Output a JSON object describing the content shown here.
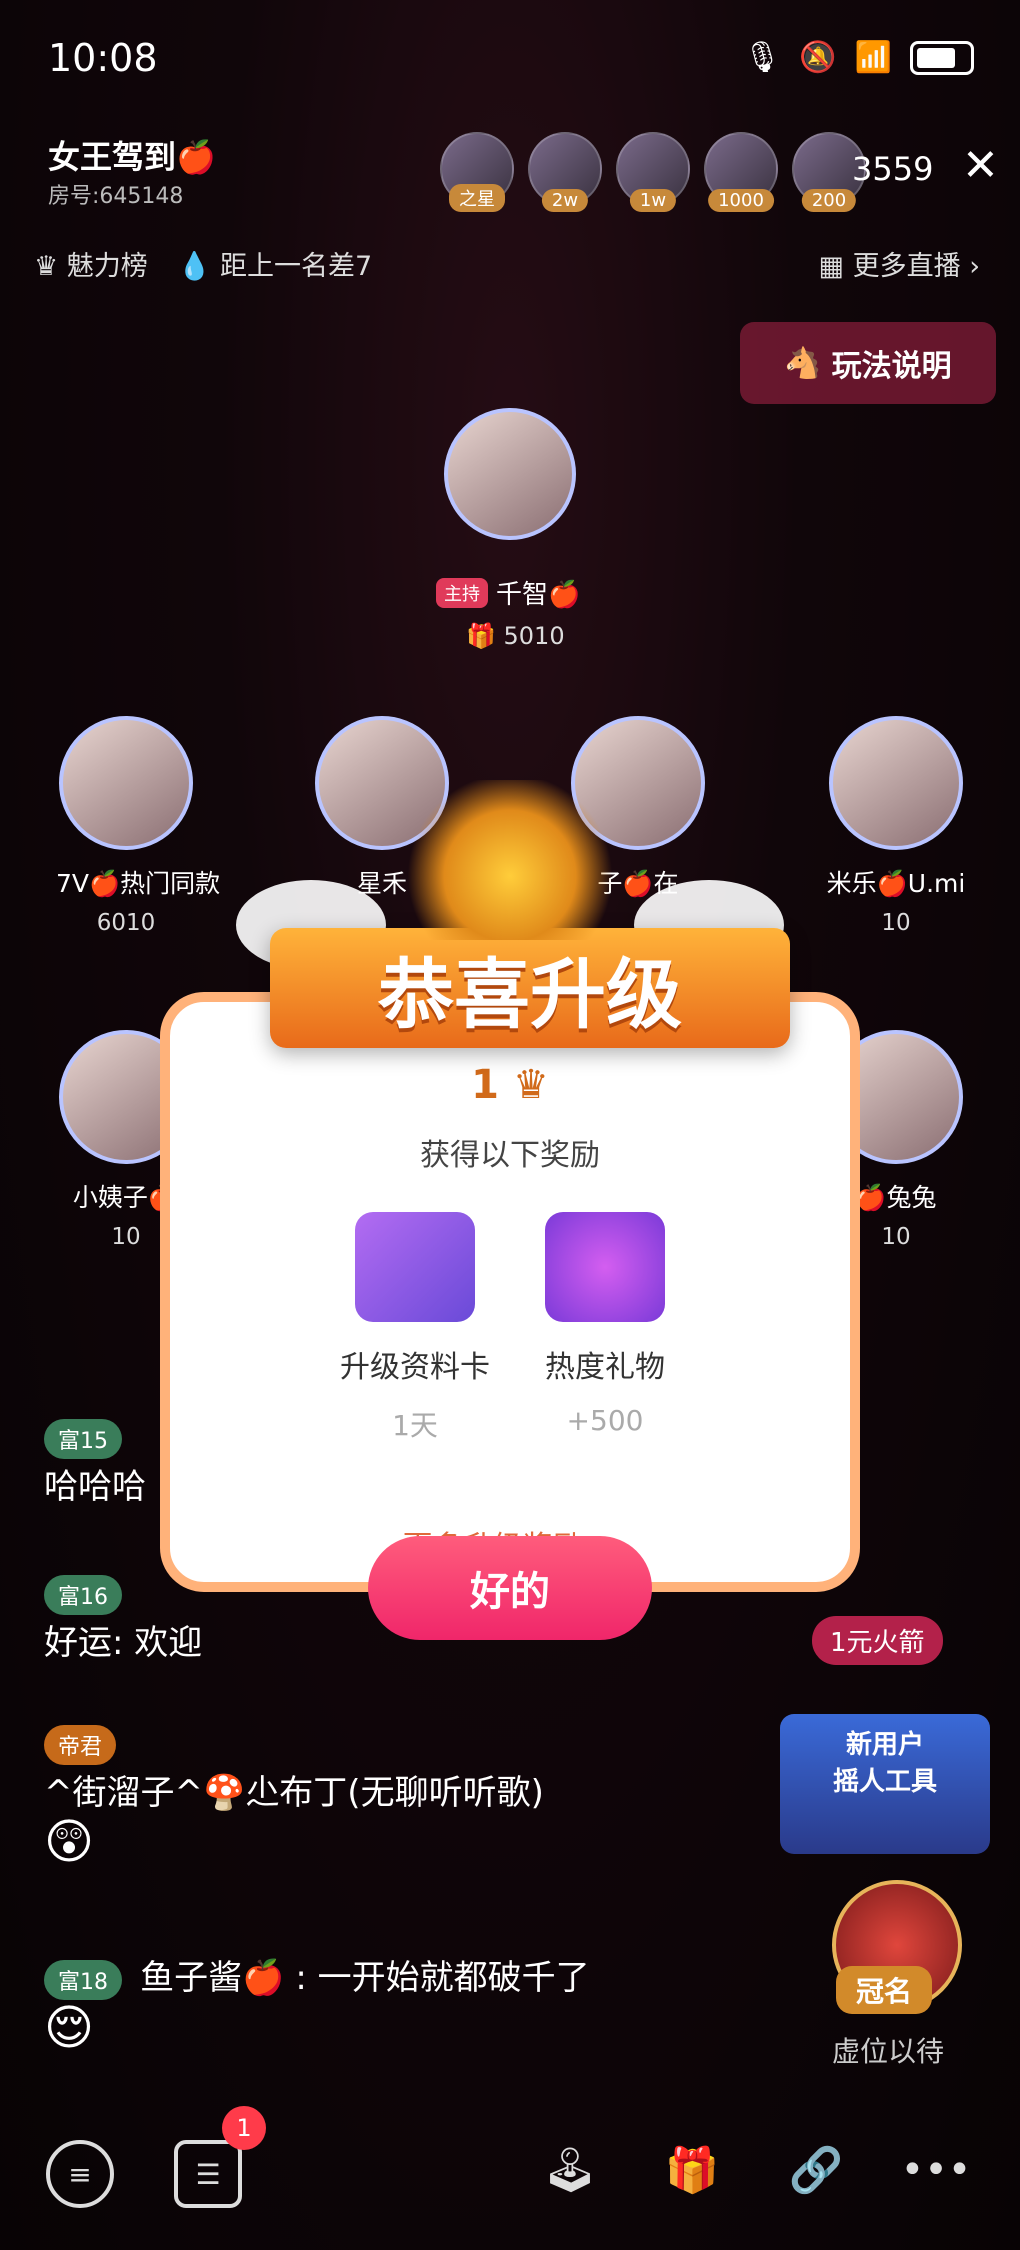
{
  "status": {
    "time": "10:08"
  },
  "header": {
    "room_title": "女王驾到🍎",
    "room_id": "房号:645148",
    "viewers": [
      {
        "tag": "之星"
      },
      {
        "tag": "2w"
      },
      {
        "tag": "1w"
      },
      {
        "tag": "1000"
      },
      {
        "tag": "200"
      }
    ],
    "viewer_count": "3559"
  },
  "subbar": {
    "charm_rank": "魅力榜",
    "rank_gap": "距上一名差7",
    "more_live": "更多直播",
    "rules": "玩法说明"
  },
  "host": {
    "tag": "主持",
    "name": "千智🍎",
    "score": "5010"
  },
  "seats": [
    {
      "name": "7V🍎热门同款",
      "score": "6010"
    },
    {
      "name": "星禾",
      "score": ""
    },
    {
      "name": "子🍎在",
      "score": ""
    },
    {
      "name": "米乐🍎U.mi",
      "score": "10"
    },
    {
      "name": "小姨子🍎",
      "score": "10"
    },
    {
      "name": "🍎兔兔",
      "score": "10"
    }
  ],
  "chat": [
    {
      "level": "富15",
      "text": "哈哈哈"
    },
    {
      "level": "富16",
      "text": "好运: 欢迎"
    },
    {
      "level": "帝君",
      "text": "^街溜子^🍄尐布丁(无聊听听歌)"
    },
    {
      "level": "富18",
      "text": "鱼子酱🍎 : 一开始就都破千了"
    }
  ],
  "right": {
    "rocket": "1元火箭",
    "new_user": "新用户\n摇人工具",
    "sponsor_label": "冠名",
    "sponsor_sub": "虚位以待"
  },
  "modal": {
    "title": "恭喜升级",
    "level": "1",
    "reward_title": "获得以下奖励",
    "rewards": [
      {
        "name": "升级资料卡",
        "value": "1天"
      },
      {
        "name": "热度礼物",
        "value": "+500"
      }
    ],
    "more": "更多升级奖励 >",
    "ok": "好的"
  },
  "bottom": {
    "badge": "1"
  }
}
